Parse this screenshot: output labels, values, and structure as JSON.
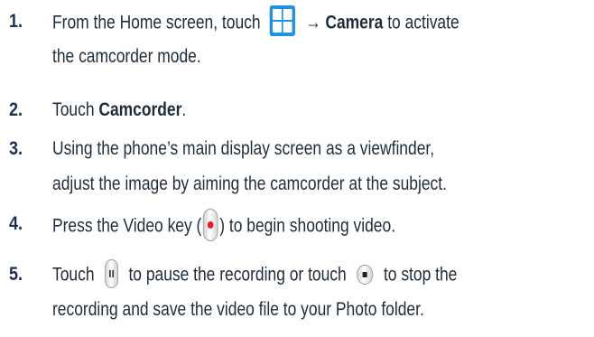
{
  "steps": [
    {
      "number": "1.",
      "text_a": "From the Home screen, touch",
      "arrow": "→",
      "bold_a": "Camera",
      "text_b": "to activate",
      "line2": "the camcorder mode.",
      "icon": "apps-grid-icon"
    },
    {
      "number": "2.",
      "text_a": "Touch",
      "bold_a": "Camcorder",
      "text_b": "."
    },
    {
      "number": "3.",
      "line1": "Using the phone’s main display screen as a viewfinder,",
      "line2": "adjust the image by aiming the camcorder at the subject."
    },
    {
      "number": "4.",
      "text_a": "Press the Video key (",
      "text_b": ") to begin shooting video.",
      "icon": "video-record-key-icon"
    },
    {
      "number": "5.",
      "text_a": "Touch",
      "text_b": "to pause the recording or touch",
      "text_c": "to stop the",
      "line2": "recording and save the video file to your Photo folder.",
      "icons": [
        "pause-key-icon",
        "stop-key-icon"
      ]
    }
  ],
  "colors": {
    "number": "#1c2f52",
    "body_text": "#1f2d3a",
    "apps_icon": "#1f92e0",
    "record_dot": "#e0202a"
  }
}
